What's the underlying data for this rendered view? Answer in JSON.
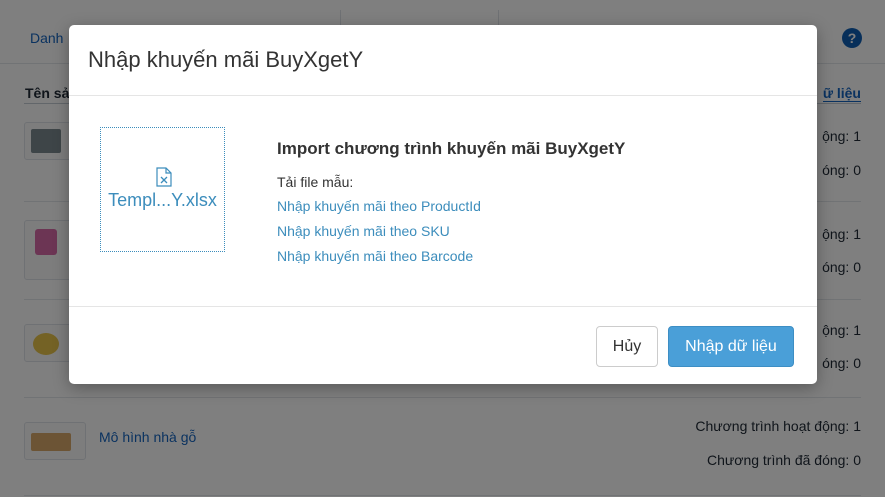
{
  "background": {
    "tab_first": "Danh",
    "help_icon_glyph": "?",
    "column_header": "Tên sả",
    "import_link_partial": "ữ liệu",
    "rows": [
      {
        "status_active": "ộng: 1",
        "status_closed": "óng: 0"
      },
      {
        "status_active": "ộng: 1",
        "status_closed": "óng: 0"
      },
      {
        "status_active": "ộng: 1",
        "status_closed": "óng: 0"
      },
      {
        "name": "Mô hình nhà gỗ",
        "status_active": "Chương trình hoạt động: 1",
        "status_closed": "Chương trình đã đóng: 0"
      }
    ]
  },
  "modal": {
    "title": "Nhập khuyến mãi BuyXgetY",
    "dropzone": {
      "file_icon": "file-excel-icon",
      "file_name": "Templ...Y.xlsx"
    },
    "import_title": "Import chương trình khuyến mãi BuyXgetY",
    "template_label": "Tải file mẫu:",
    "template_links": [
      "Nhập khuyến mãi theo ProductId",
      "Nhập khuyến mãi theo SKU",
      "Nhập khuyến mãi theo Barcode"
    ],
    "cancel_label": "Hủy",
    "import_label": "Nhập dữ liệu"
  },
  "colors": {
    "link": "#3c8dbc",
    "primary_button": "#4a9fd8",
    "overlay": "rgba(0,0,0,0.5)"
  }
}
